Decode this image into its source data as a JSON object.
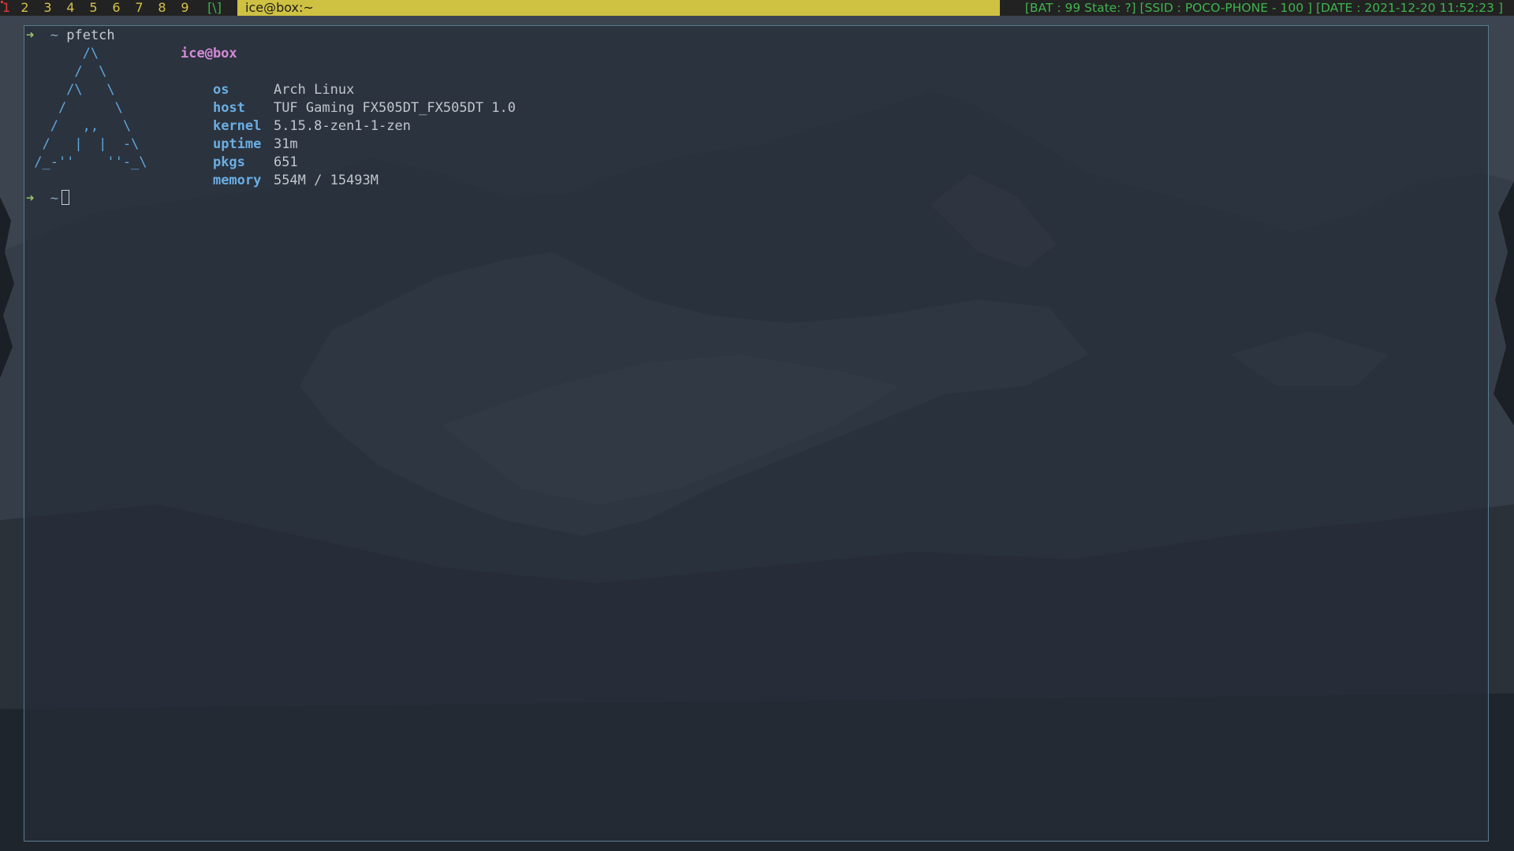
{
  "topbar": {
    "tags": [
      "1",
      "2",
      "3",
      "4",
      "5",
      "6",
      "7",
      "8",
      "9"
    ],
    "active_tag": "1",
    "layout_symbol": "[\\]",
    "window_title": "ice@box:~",
    "status": "[BAT : 99 State: ?] [SSID : POCO-PHONE - 100 ] [DATE : 2021-12-20 11:52:23 ]",
    "colors": {
      "bar_bg": "#222222",
      "title_bg": "#cfc142",
      "tag_fg": "#d6c24a",
      "active_tag_fg": "#e03a3a",
      "status_fg": "#3fb34f"
    }
  },
  "terminal": {
    "prompt_arrow": "➜",
    "prompt_dir": "~",
    "command": "pfetch",
    "ascii_logo": [
      "       /\\",
      "      /  \\",
      "     /\\   \\",
      "    /      \\",
      "   /   ,,   \\",
      "  /   |  |  -\\",
      " /_-''    ''-_\\"
    ],
    "userhost": "ice@box",
    "info": [
      {
        "key": "os",
        "value": "Arch Linux"
      },
      {
        "key": "host",
        "value": "TUF Gaming FX505DT_FX505DT 1.0"
      },
      {
        "key": "kernel",
        "value": "5.15.8-zen1-1-zen"
      },
      {
        "key": "uptime",
        "value": "31m"
      },
      {
        "key": "pkgs",
        "value": "651"
      },
      {
        "key": "memory",
        "value": "554M / 15493M"
      }
    ],
    "colors": {
      "logo": "#5ea8dd",
      "keys": "#6aaee3",
      "userhost": "#d48ad6",
      "prompt_arrow": "#9bc56a",
      "border": "#5a7d8f"
    }
  },
  "wallpaper": {
    "subject": "snowy mountain"
  }
}
